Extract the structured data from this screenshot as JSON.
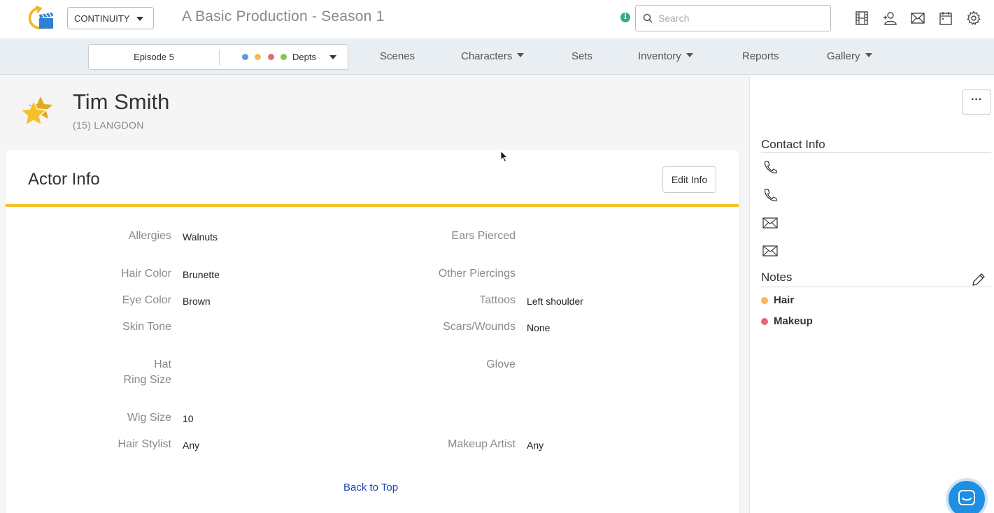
{
  "header": {
    "app_select": "CONTINUITY",
    "production_title": "A Basic Production - Season 1",
    "search_placeholder": "Search",
    "info_icon": "i"
  },
  "nav": {
    "episode": "Episode 5",
    "depts_label": "Depts",
    "dept_colors": [
      "#5b9be0",
      "#f4b95a",
      "#e6677b",
      "#8bc34a"
    ],
    "items": [
      {
        "label": "Scenes",
        "dropdown": false
      },
      {
        "label": "Characters",
        "dropdown": true
      },
      {
        "label": "Sets",
        "dropdown": false
      },
      {
        "label": "Inventory",
        "dropdown": true
      },
      {
        "label": "Reports",
        "dropdown": false
      },
      {
        "label": "Gallery",
        "dropdown": true
      }
    ]
  },
  "character": {
    "name": "Tim Smith",
    "subtitle": "(15) LANGDON"
  },
  "actor_info": {
    "title": "Actor Info",
    "edit_label": "Edit Info",
    "back_to_top": "Back to Top",
    "left_fields": [
      {
        "label": "Allergies",
        "value": "Walnuts"
      },
      {
        "label": "Hair Color",
        "value": "Brunette"
      },
      {
        "label": "Eye Color",
        "value": "Brown"
      },
      {
        "label": "Skin Tone",
        "value": ""
      },
      {
        "label": "Hat Ring Size",
        "value": ""
      },
      {
        "label": "Wig Size",
        "value": "10"
      },
      {
        "label": "Hair Stylist",
        "value": "Any"
      }
    ],
    "right_fields": [
      {
        "label": "Ears Pierced",
        "value": ""
      },
      {
        "label": "Other Piercings",
        "value": ""
      },
      {
        "label": "Tattoos",
        "value": "Left shoulder"
      },
      {
        "label": "Scars/Wounds",
        "value": "None"
      },
      {
        "label": "Glove",
        "value": ""
      },
      {
        "label": "Makeup Artist",
        "value": "Any"
      }
    ]
  },
  "side_panel": {
    "more_label": "···",
    "contact_title": "Contact Info",
    "contact_icons": [
      "phone-icon",
      "phone-icon",
      "mail-icon",
      "mail-icon"
    ],
    "notes_title": "Notes",
    "notes": [
      {
        "label": "Hair",
        "color": "#f4b95a"
      },
      {
        "label": "Makeup",
        "color": "#e6677b"
      }
    ]
  }
}
